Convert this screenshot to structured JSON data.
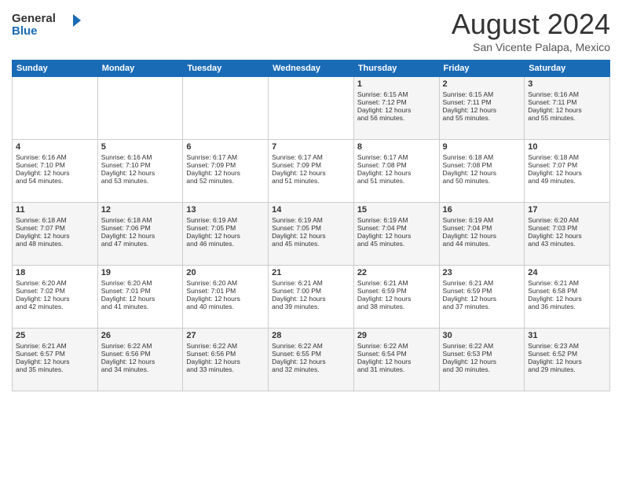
{
  "logo": {
    "line1": "General",
    "line2": "Blue"
  },
  "title": "August 2024",
  "location": "San Vicente Palapa, Mexico",
  "days_of_week": [
    "Sunday",
    "Monday",
    "Tuesday",
    "Wednesday",
    "Thursday",
    "Friday",
    "Saturday"
  ],
  "weeks": [
    [
      {
        "day": "",
        "content": ""
      },
      {
        "day": "",
        "content": ""
      },
      {
        "day": "",
        "content": ""
      },
      {
        "day": "",
        "content": ""
      },
      {
        "day": "1",
        "content": "Sunrise: 6:15 AM\nSunset: 7:12 PM\nDaylight: 12 hours\nand 56 minutes."
      },
      {
        "day": "2",
        "content": "Sunrise: 6:15 AM\nSunset: 7:11 PM\nDaylight: 12 hours\nand 55 minutes."
      },
      {
        "day": "3",
        "content": "Sunrise: 6:16 AM\nSunset: 7:11 PM\nDaylight: 12 hours\nand 55 minutes."
      }
    ],
    [
      {
        "day": "4",
        "content": "Sunrise: 6:16 AM\nSunset: 7:10 PM\nDaylight: 12 hours\nand 54 minutes."
      },
      {
        "day": "5",
        "content": "Sunrise: 6:16 AM\nSunset: 7:10 PM\nDaylight: 12 hours\nand 53 minutes."
      },
      {
        "day": "6",
        "content": "Sunrise: 6:17 AM\nSunset: 7:09 PM\nDaylight: 12 hours\nand 52 minutes."
      },
      {
        "day": "7",
        "content": "Sunrise: 6:17 AM\nSunset: 7:09 PM\nDaylight: 12 hours\nand 51 minutes."
      },
      {
        "day": "8",
        "content": "Sunrise: 6:17 AM\nSunset: 7:08 PM\nDaylight: 12 hours\nand 51 minutes."
      },
      {
        "day": "9",
        "content": "Sunrise: 6:18 AM\nSunset: 7:08 PM\nDaylight: 12 hours\nand 50 minutes."
      },
      {
        "day": "10",
        "content": "Sunrise: 6:18 AM\nSunset: 7:07 PM\nDaylight: 12 hours\nand 49 minutes."
      }
    ],
    [
      {
        "day": "11",
        "content": "Sunrise: 6:18 AM\nSunset: 7:07 PM\nDaylight: 12 hours\nand 48 minutes."
      },
      {
        "day": "12",
        "content": "Sunrise: 6:18 AM\nSunset: 7:06 PM\nDaylight: 12 hours\nand 47 minutes."
      },
      {
        "day": "13",
        "content": "Sunrise: 6:19 AM\nSunset: 7:05 PM\nDaylight: 12 hours\nand 46 minutes."
      },
      {
        "day": "14",
        "content": "Sunrise: 6:19 AM\nSunset: 7:05 PM\nDaylight: 12 hours\nand 45 minutes."
      },
      {
        "day": "15",
        "content": "Sunrise: 6:19 AM\nSunset: 7:04 PM\nDaylight: 12 hours\nand 45 minutes."
      },
      {
        "day": "16",
        "content": "Sunrise: 6:19 AM\nSunset: 7:04 PM\nDaylight: 12 hours\nand 44 minutes."
      },
      {
        "day": "17",
        "content": "Sunrise: 6:20 AM\nSunset: 7:03 PM\nDaylight: 12 hours\nand 43 minutes."
      }
    ],
    [
      {
        "day": "18",
        "content": "Sunrise: 6:20 AM\nSunset: 7:02 PM\nDaylight: 12 hours\nand 42 minutes."
      },
      {
        "day": "19",
        "content": "Sunrise: 6:20 AM\nSunset: 7:01 PM\nDaylight: 12 hours\nand 41 minutes."
      },
      {
        "day": "20",
        "content": "Sunrise: 6:20 AM\nSunset: 7:01 PM\nDaylight: 12 hours\nand 40 minutes."
      },
      {
        "day": "21",
        "content": "Sunrise: 6:21 AM\nSunset: 7:00 PM\nDaylight: 12 hours\nand 39 minutes."
      },
      {
        "day": "22",
        "content": "Sunrise: 6:21 AM\nSunset: 6:59 PM\nDaylight: 12 hours\nand 38 minutes."
      },
      {
        "day": "23",
        "content": "Sunrise: 6:21 AM\nSunset: 6:59 PM\nDaylight: 12 hours\nand 37 minutes."
      },
      {
        "day": "24",
        "content": "Sunrise: 6:21 AM\nSunset: 6:58 PM\nDaylight: 12 hours\nand 36 minutes."
      }
    ],
    [
      {
        "day": "25",
        "content": "Sunrise: 6:21 AM\nSunset: 6:57 PM\nDaylight: 12 hours\nand 35 minutes."
      },
      {
        "day": "26",
        "content": "Sunrise: 6:22 AM\nSunset: 6:56 PM\nDaylight: 12 hours\nand 34 minutes."
      },
      {
        "day": "27",
        "content": "Sunrise: 6:22 AM\nSunset: 6:56 PM\nDaylight: 12 hours\nand 33 minutes."
      },
      {
        "day": "28",
        "content": "Sunrise: 6:22 AM\nSunset: 6:55 PM\nDaylight: 12 hours\nand 32 minutes."
      },
      {
        "day": "29",
        "content": "Sunrise: 6:22 AM\nSunset: 6:54 PM\nDaylight: 12 hours\nand 31 minutes."
      },
      {
        "day": "30",
        "content": "Sunrise: 6:22 AM\nSunset: 6:53 PM\nDaylight: 12 hours\nand 30 minutes."
      },
      {
        "day": "31",
        "content": "Sunrise: 6:23 AM\nSunset: 6:52 PM\nDaylight: 12 hours\nand 29 minutes."
      }
    ]
  ]
}
